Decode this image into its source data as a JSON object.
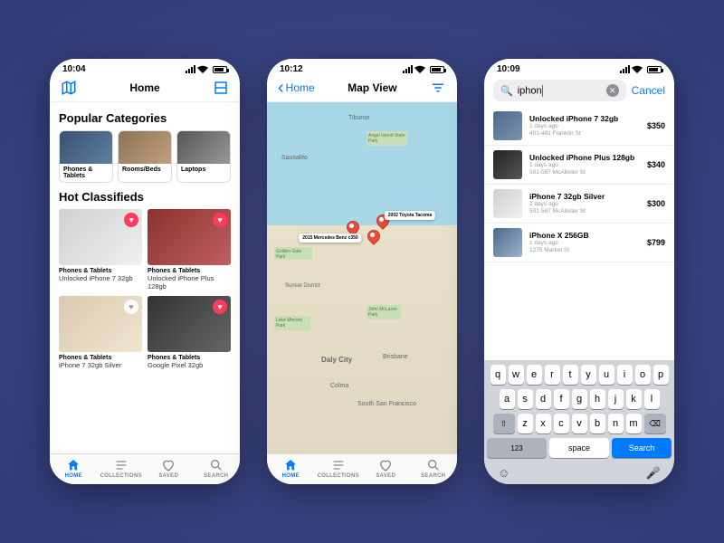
{
  "phone1": {
    "time": "10:04",
    "title": "Home",
    "section_categories": "Popular Categories",
    "categories": [
      {
        "label": "Phones & Tablets"
      },
      {
        "label": "Rooms/Beds"
      },
      {
        "label": "Laptops"
      }
    ],
    "section_hot": "Hot Classifieds",
    "items": [
      {
        "category": "Phones & Tablets",
        "name": "Unlocked iPhone 7 32gb",
        "favorite": true
      },
      {
        "category": "Phones & Tablets",
        "name": "Unlocked iPhone Plus 128gb",
        "favorite": true
      },
      {
        "category": "Phones & Tablets",
        "name": "iPhone 7 32gb Silver",
        "favorite": false
      },
      {
        "category": "Phones & Tablets",
        "name": "Google Pixel 32gb",
        "favorite": true
      }
    ]
  },
  "phone2": {
    "time": "10:12",
    "back": "Home",
    "title": "Map View",
    "map_labels": {
      "tiburon": "Tiburon",
      "sausalito": "Sausalito",
      "angel_island": "Angel Island State Park",
      "golden_gate": "Golden Gate Park",
      "sunset": "Sunset District",
      "lake_merced": "Lake Merced Park",
      "mclaren": "John McLaren Park",
      "daly": "Daly City",
      "brisbane": "Brisbane",
      "colma": "Colma",
      "ssf": "South San Francisco"
    },
    "callouts": [
      {
        "text": "2015 Mercedes Benz c350"
      },
      {
        "text": "2002 Toyota Tacoma"
      }
    ]
  },
  "phone3": {
    "time": "10:09",
    "search_value": "iphon",
    "cancel": "Cancel",
    "results": [
      {
        "title": "Unlocked iPhone 7 32gb",
        "age": "1 days ago",
        "addr": "401-481 Franklin St",
        "price": "$350"
      },
      {
        "title": "Unlocked iPhone Plus 128gb",
        "age": "1 days ago",
        "addr": "501-587 McAllister St",
        "price": "$340"
      },
      {
        "title": "iPhone 7 32gb Silver",
        "age": "1 days ago",
        "addr": "501-587 McAllister St",
        "price": "$300"
      },
      {
        "title": "iPhone X 256GB",
        "age": "1 days ago",
        "addr": "1275 Market St",
        "price": "$799"
      }
    ],
    "keyboard": {
      "row1": [
        "q",
        "w",
        "e",
        "r",
        "t",
        "y",
        "u",
        "i",
        "o",
        "p"
      ],
      "row2": [
        "a",
        "s",
        "d",
        "f",
        "g",
        "h",
        "j",
        "k",
        "l"
      ],
      "row3": [
        "z",
        "x",
        "c",
        "v",
        "b",
        "n",
        "m"
      ],
      "num": "123",
      "space": "space",
      "search": "Search"
    }
  },
  "tabs": [
    {
      "label": "HOME"
    },
    {
      "label": "COLLECTIONS"
    },
    {
      "label": "SAVED"
    },
    {
      "label": "SEARCH"
    }
  ]
}
